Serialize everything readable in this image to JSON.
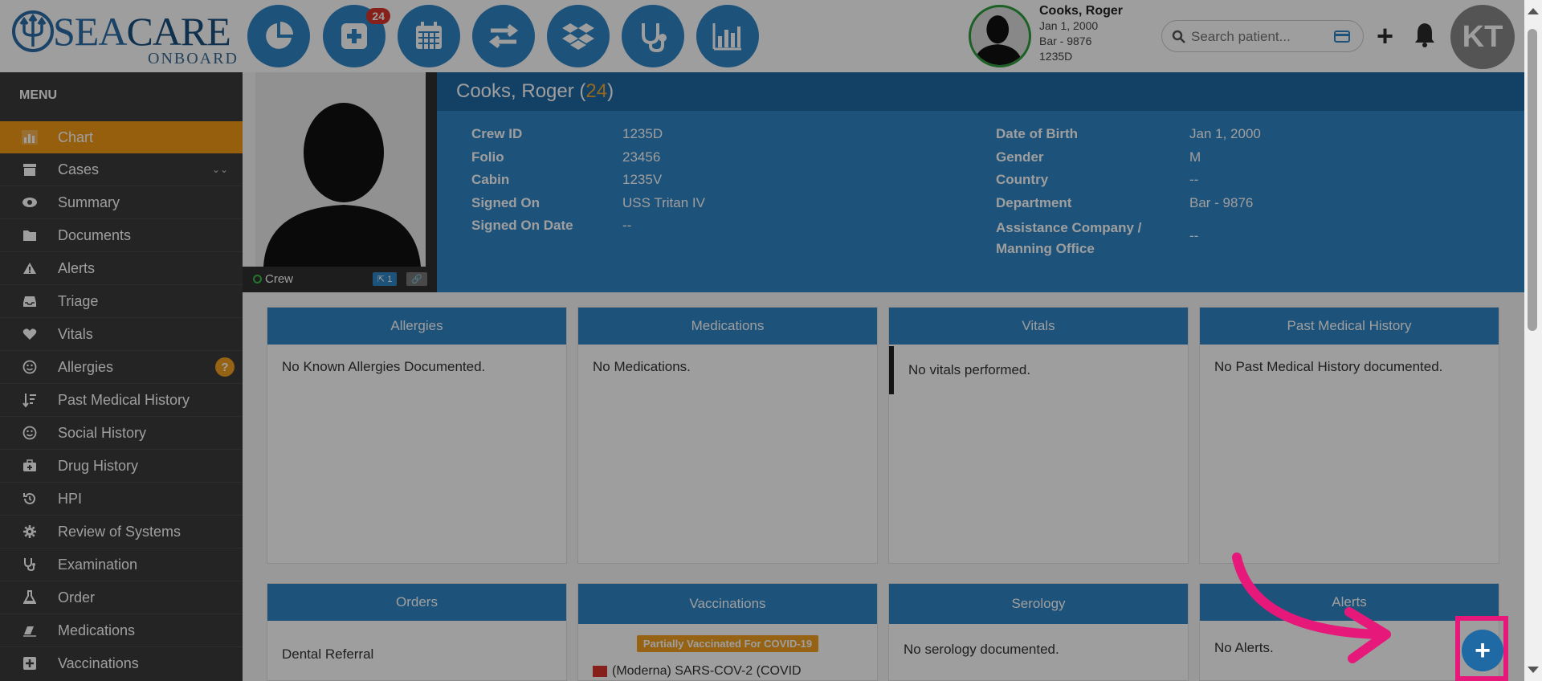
{
  "logo": {
    "brand_sea": "SEA",
    "brand_care": "CARE",
    "brand_sub": "ONBOARD"
  },
  "topnav": {
    "buttons": [
      {
        "icon": "pie-chart-icon"
      },
      {
        "icon": "medical-plus-icon",
        "badge": "24"
      },
      {
        "icon": "calendar-icon"
      },
      {
        "icon": "transfer-arrows-icon"
      },
      {
        "icon": "dropbox-icon"
      },
      {
        "icon": "stethoscope-icon"
      },
      {
        "icon": "bar-chart-icon"
      }
    ]
  },
  "current_patient": {
    "name": "Cooks, Roger",
    "dob": "Jan 1, 2000",
    "department": "Bar - 9876",
    "crew_id": "1235D"
  },
  "search": {
    "placeholder": "Search patient..."
  },
  "user": {
    "initials": "KT"
  },
  "sidebar": {
    "title": "MENU",
    "items": [
      {
        "label": "Chart",
        "icon": "bar-chart-icon",
        "active": true
      },
      {
        "label": "Cases",
        "icon": "archive-icon"
      },
      {
        "label": "Summary",
        "icon": "eye-icon"
      },
      {
        "label": "Documents",
        "icon": "folder-icon"
      },
      {
        "label": "Alerts",
        "icon": "warning-icon"
      },
      {
        "label": "Triage",
        "icon": "inbox-icon"
      },
      {
        "label": "Vitals",
        "icon": "heart-icon"
      },
      {
        "label": "Allergies",
        "icon": "smile-icon",
        "help": "?"
      },
      {
        "label": "Past Medical History",
        "icon": "sort-icon"
      },
      {
        "label": "Social History",
        "icon": "smile-icon"
      },
      {
        "label": "Drug History",
        "icon": "medkit-icon"
      },
      {
        "label": "HPI",
        "icon": "history-icon"
      },
      {
        "label": "Review of Systems",
        "icon": "gear-icon"
      },
      {
        "label": "Examination",
        "icon": "stethoscope-icon"
      },
      {
        "label": "Order",
        "icon": "flask-icon"
      },
      {
        "label": "Medications",
        "icon": "eraser-icon"
      },
      {
        "label": "Vaccinations",
        "icon": "plus-square-icon"
      }
    ]
  },
  "profile": {
    "name": "Cooks, Roger",
    "age": "24",
    "photo_label": "Crew",
    "photo_badge_count": "1",
    "left_fields": [
      {
        "label": "Crew ID",
        "value": "1235D"
      },
      {
        "label": "Folio",
        "value": "23456"
      },
      {
        "label": "Cabin",
        "value": "1235V"
      },
      {
        "label": "Signed On",
        "value": "USS Tritan IV"
      },
      {
        "label": "Signed On Date",
        "value": "--"
      }
    ],
    "right_fields": [
      {
        "label": "Date of Birth",
        "value": "Jan 1, 2000"
      },
      {
        "label": "Gender",
        "value": "M"
      },
      {
        "label": "Country",
        "value": "--"
      },
      {
        "label": "Department",
        "value": "Bar - 9876"
      },
      {
        "label": "Assistance Company / Manning Office",
        "value": "--"
      }
    ]
  },
  "cards_row1": [
    {
      "title": "Allergies",
      "body": "No Known Allergies Documented."
    },
    {
      "title": "Medications",
      "body": "No Medications."
    },
    {
      "title": "Vitals",
      "body": "No vitals performed."
    },
    {
      "title": "Past Medical History",
      "body": "No Past Medical History documented."
    }
  ],
  "cards_row2": [
    {
      "title": "Orders",
      "body": "Dental Referral"
    },
    {
      "title": "Vaccinations",
      "tag": "Partially Vaccinated For COVID-19",
      "body": "(Moderna) SARS-COV-2 (COVID"
    },
    {
      "title": "Serology",
      "body": "No serology documented."
    },
    {
      "title": "Alerts",
      "body": "No Alerts."
    }
  ],
  "fab": {
    "label": "+"
  },
  "colors": {
    "primary": "#2f85c6",
    "dark_primary": "#1f6aa5",
    "accent": "#f39a16",
    "highlight": "#e6197a",
    "sidebar": "#3a3a3a"
  }
}
